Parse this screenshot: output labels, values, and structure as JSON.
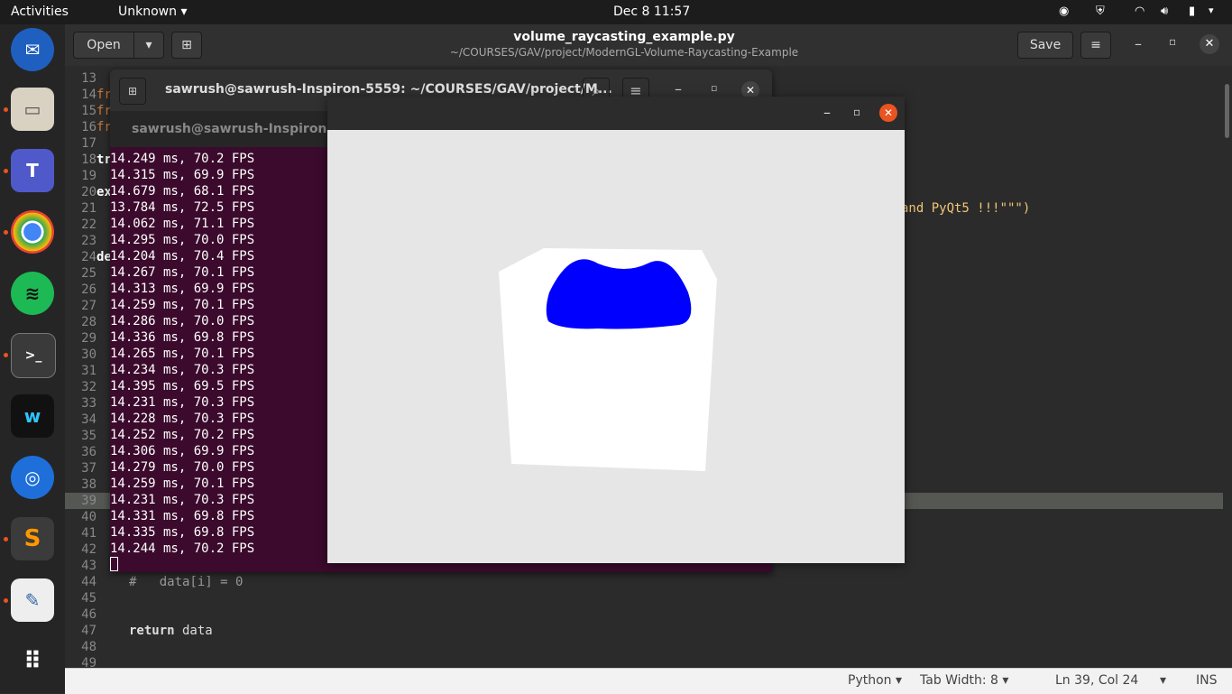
{
  "topbar": {
    "activities": "Activities",
    "app_menu": "Unknown",
    "clock": "Dec 8  11:57"
  },
  "dock": {
    "items": [
      "thunderbird-icon",
      "files-icon",
      "teams-icon",
      "chrome-icon",
      "spotify-icon",
      "terminal-icon",
      "webex-icon",
      "cisco-icon",
      "sublime-icon",
      "text-editor-icon",
      "apps-grid-icon"
    ]
  },
  "gedit": {
    "open_label": "Open",
    "save_label": "Save",
    "title": "volume_raycasting_example.py",
    "path": "~/COURSES/GAV/project/ModernGL-Volume-Raycasting-Example"
  },
  "editor": {
    "gutter_lines": [
      "13",
      "14",
      "15",
      "16",
      "17",
      "18",
      "19",
      "20",
      "21",
      "22",
      "23",
      "24",
      "25",
      "26",
      "27",
      "28",
      "29",
      "30",
      "31",
      "32",
      "33",
      "34",
      "35",
      "36",
      "37",
      "38",
      "39",
      "40",
      "41",
      "42",
      "43",
      "44",
      "45",
      "46",
      "47",
      "48",
      "49"
    ],
    "code_left": [
      "",
      "fr",
      "fr",
      "fr",
      "",
      "tr",
      "",
      "ex",
      "",
      "",
      "",
      "de"
    ],
    "fragment_right": "and PyQt5 !!!\"\"\")",
    "line44": "#   data[i] = 0",
    "line47_kw": "return",
    "line47_rest": " data"
  },
  "terminal": {
    "title": "sawrush@sawrush-Inspiron-5559: ~/COURSES/GAV/project/M...",
    "tab": "sawrush@sawrush-Inspiron-5559",
    "lines": [
      "14.249 ms, 70.2 FPS",
      "14.315 ms, 69.9 FPS",
      "14.679 ms, 68.1 FPS",
      "13.784 ms, 72.5 FPS",
      "14.062 ms, 71.1 FPS",
      "14.295 ms, 70.0 FPS",
      "14.204 ms, 70.4 FPS",
      "14.267 ms, 70.1 FPS",
      "14.313 ms, 69.9 FPS",
      "14.259 ms, 70.1 FPS",
      "14.286 ms, 70.0 FPS",
      "14.336 ms, 69.8 FPS",
      "14.265 ms, 70.1 FPS",
      "14.234 ms, 70.3 FPS",
      "14.395 ms, 69.5 FPS",
      "14.231 ms, 70.3 FPS",
      "14.228 ms, 70.3 FPS",
      "14.252 ms, 70.2 FPS",
      "14.306 ms, 69.9 FPS",
      "14.279 ms, 70.0 FPS",
      "14.259 ms, 70.1 FPS",
      "14.231 ms, 70.3 FPS",
      "14.331 ms, 69.8 FPS",
      "14.335 ms, 69.8 FPS",
      "14.244 ms, 70.2 FPS"
    ]
  },
  "statusbar": {
    "language": "Python",
    "tab_width": "Tab Width: 8",
    "position": "Ln 39, Col 24",
    "mode": "INS"
  },
  "colors": {
    "accent": "#e95420",
    "terminal_bg": "#3b0a2c",
    "volume_blue": "#0000ff"
  }
}
